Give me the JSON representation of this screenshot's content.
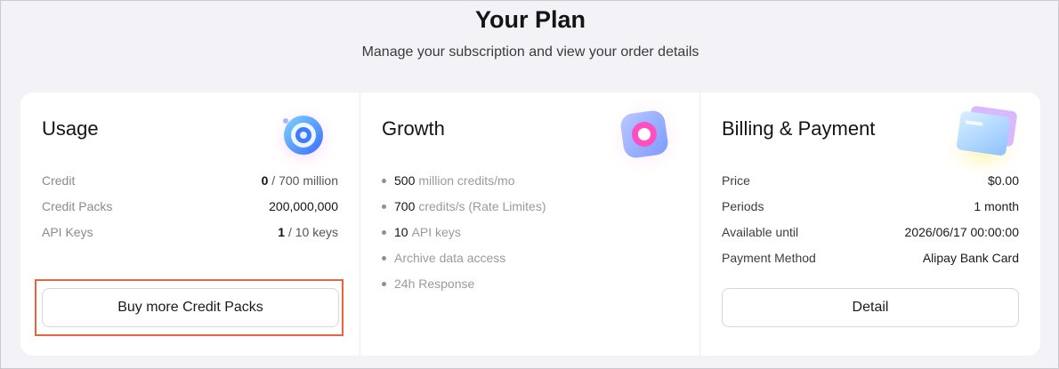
{
  "header": {
    "title": "Your Plan",
    "subtitle": "Manage your subscription and view your order details"
  },
  "usage": {
    "title": "Usage",
    "illustration": "target-ring-icon",
    "rows": [
      {
        "label": "Credit",
        "value_strong": "0",
        "value_rest": " / 700 million"
      },
      {
        "label": "Credit Packs",
        "value_strong": "",
        "value_rest": "200,000,000"
      },
      {
        "label": "API Keys",
        "value_strong": "1",
        "value_rest": " / 10 keys"
      }
    ],
    "button_label": "Buy more Credit Packs"
  },
  "growth": {
    "title": "Growth",
    "illustration": "growth-badge-icon",
    "bullets": [
      {
        "strong": "500",
        "text": "million credits/mo"
      },
      {
        "strong": "700",
        "text": "credits/s (Rate Limites)"
      },
      {
        "strong": "10",
        "text": "API keys"
      },
      {
        "strong": "",
        "text": "Archive data access"
      },
      {
        "strong": "",
        "text": "24h Response"
      }
    ]
  },
  "billing": {
    "title": "Billing & Payment",
    "illustration": "cards-icon",
    "rows": [
      {
        "label": "Price",
        "value": "$0.00"
      },
      {
        "label": "Periods",
        "value": "1 month"
      },
      {
        "label": "Available until",
        "value": "2026/06/17 00:00:00"
      },
      {
        "label": "Payment Method",
        "value": "Alipay Bank Card"
      }
    ],
    "button_label": "Detail"
  },
  "colors": {
    "highlight": "#e8643c",
    "background": "#f3f3f7",
    "card": "#ffffff"
  }
}
